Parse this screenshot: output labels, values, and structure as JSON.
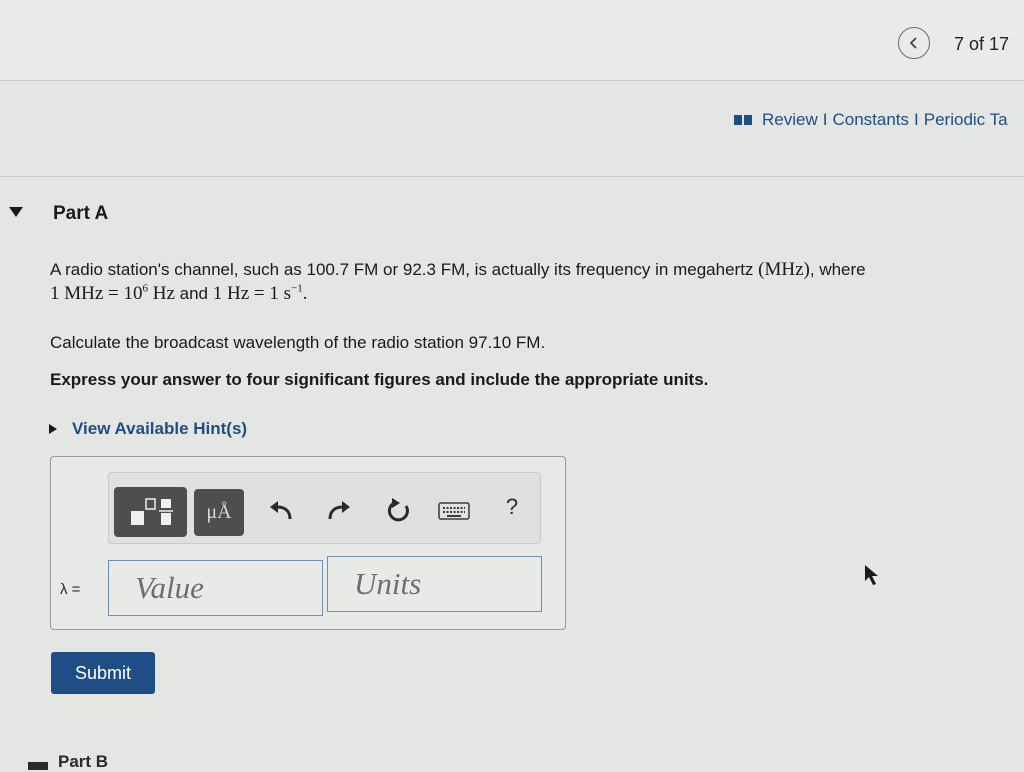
{
  "header": {
    "prev_icon": "chevron-left-icon",
    "page_counter": "7 of 17"
  },
  "resources": {
    "icon": "book-icon",
    "review": "Review",
    "separator": "I",
    "constants": "Constants",
    "periodic": "Periodic Ta"
  },
  "part": {
    "title": "Part A",
    "intro_text": "A radio station's channel, such as 100.7 FM or 92.3 FM, is actually its frequency in megahertz",
    "intro_unit": "(MHz)",
    "intro_where": ", where",
    "eq1_lhs": "1 MHz = 10",
    "eq1_exp": "6",
    "eq1_rhs": " Hz",
    "and": " and ",
    "eq2": "1 Hz = 1 s",
    "eq2_exp": "−1",
    "period": ".",
    "question": "Calculate the broadcast wavelength of the radio station 97.10 FM.",
    "instruction": "Express your answer to four significant figures and include the appropriate units.",
    "hint_label": "View Available Hint(s)"
  },
  "toolbar": {
    "units_label": "μÅ",
    "help_label": "?"
  },
  "answer": {
    "variable": "λ =",
    "value_placeholder": "Value",
    "units_placeholder": "Units"
  },
  "submit_label": "Submit",
  "next_part_title": "Part B",
  "colors": {
    "link": "#1f4e86",
    "submit_bg": "#1f4e86",
    "toolbar_button": "#4e4e4e"
  }
}
